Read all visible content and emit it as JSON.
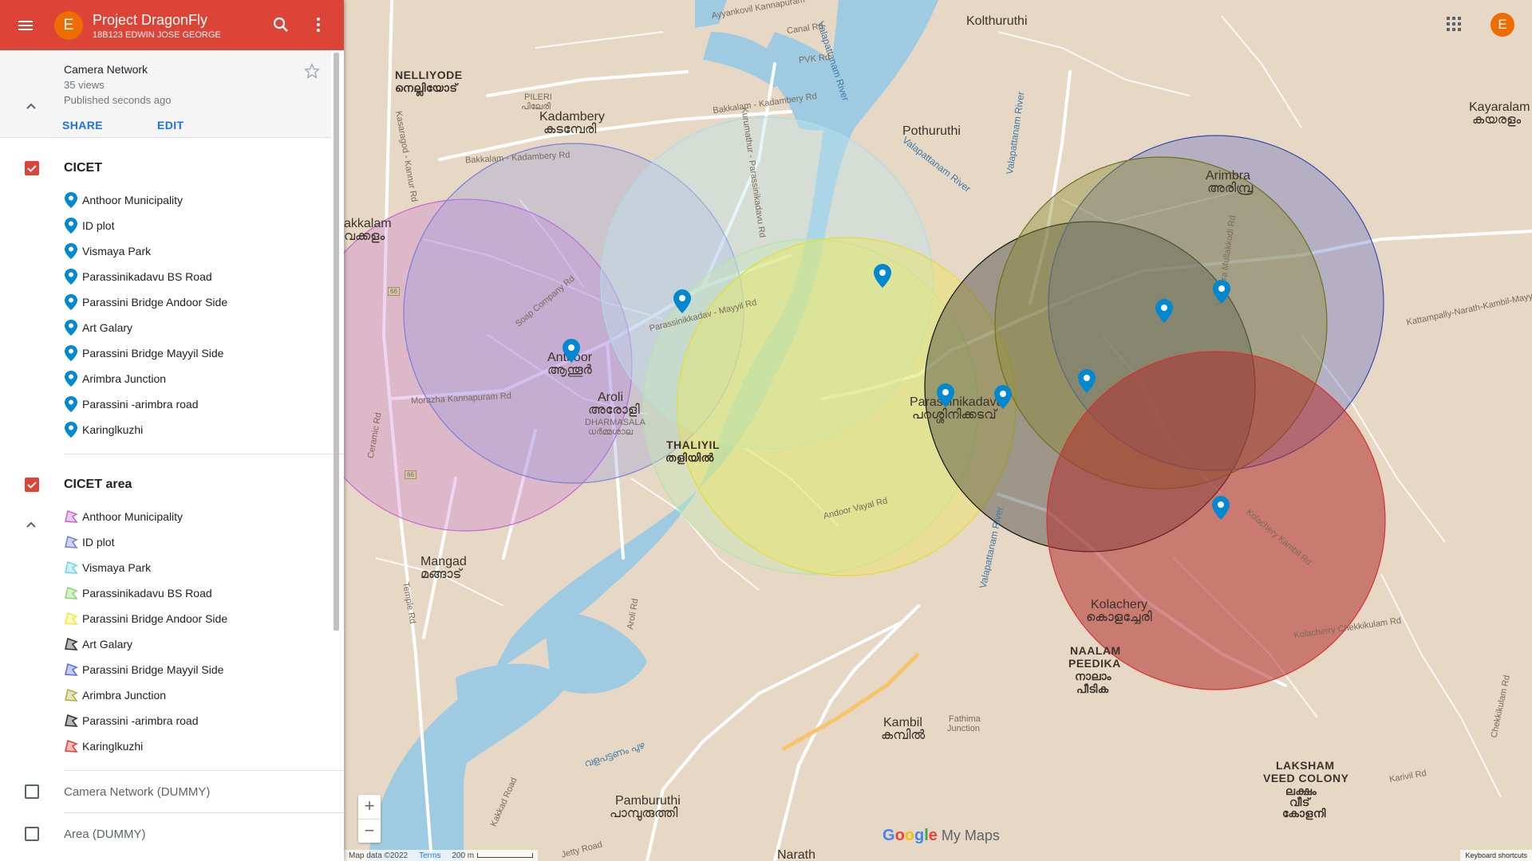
{
  "app": {
    "title": "Project DragonFly",
    "subtitle": "18B123 EDWIN JOSE GEORGE",
    "avatar_letter": "E"
  },
  "map_info": {
    "name": "Camera Network",
    "views": "35 views",
    "published": "Published seconds ago",
    "share_label": "SHARE",
    "edit_label": "EDIT"
  },
  "layers": [
    {
      "name": "CICET",
      "checked": true,
      "icon": "location-pin-icon",
      "items": [
        "Anthoor Municipality",
        "ID plot",
        "Vismaya Park",
        "Parassinikadavu BS Road",
        "Parassini Bridge Andoor Side",
        "Art Galary",
        "Parassini Bridge Mayyil Side",
        "Arimbra Junction",
        "Parassini -arimbra road",
        "Karinglkuzhi"
      ]
    },
    {
      "name": "CICET area",
      "checked": true,
      "icon": "polygon-area-icon",
      "items": [
        {
          "label": "Anthoor Municipality",
          "color": "#c766d9"
        },
        {
          "label": "ID plot",
          "color": "#7b7fd6"
        },
        {
          "label": "Vismaya Park",
          "color": "#6fd6e6"
        },
        {
          "label": "Parassinikadavu BS Road",
          "color": "#8fd66f"
        },
        {
          "label": "Parassini Bridge Andoor Side",
          "color": "#f2ea3d"
        },
        {
          "label": "Art Galary",
          "color": "#333333"
        },
        {
          "label": "Parassini Bridge Mayyil Side",
          "color": "#5a6ee6"
        },
        {
          "label": "Arimbra Junction",
          "color": "#b0b040"
        },
        {
          "label": "Parassini -arimbra road",
          "color": "#333333"
        },
        {
          "label": "Karinglkuzhi",
          "color": "#e63d3d"
        }
      ]
    },
    {
      "name": "Camera Network (DUMMY)",
      "checked": false
    },
    {
      "name": "Area (DUMMY)",
      "checked": false
    }
  ],
  "map": {
    "place_labels": {
      "kolthuruthi": "Kolthuruthi",
      "nelliyode": "NELLIYODE",
      "nelliyode_ml": "നെല്ലിയോട്",
      "kadambery": "Kadambery",
      "kadambery_ml": "കടമ്പേരി",
      "pilleri": "PILERI",
      "pilleri_ml": "പിലേരി",
      "pothuruthi": "Pothuruthi",
      "bakkalam": "akkalam",
      "bakkalam_ml": "വക്കളം",
      "anthoor": "Anthoor",
      "anthoor_ml": "ആന്തൂർ",
      "aroli": "Aroli",
      "aroli_ml": "അരോളി",
      "dharmasala": "DHARMASALA",
      "dharmasala_ml": "ധർമ്മശാല",
      "thaliyil": "THALIYIL",
      "thaliyil_ml": "തളിയിൽ",
      "parassinikadavu": "Parassinikadavu",
      "parassinikadavu_ml": "പറശ്ശിനിക്കടവ്",
      "arimbra": "Arimbra",
      "arimbra_ml": "അരിമ്പ്ര",
      "kayaralam": "Kayaralam",
      "kayaralam_ml": "കയരളം",
      "mangad": "Mangad",
      "mangad_ml": "മങ്ങാട്",
      "kolachery": "Kolachery",
      "kolachery_ml": "കൊളച്ചേരി",
      "naalam": "NAALAM",
      "peedika": "PEEDIKA",
      "naalam_ml": "നാലാം",
      "peedika_ml": "പീടിക",
      "kambil": "Kambil",
      "kambil_ml": "കമ്പിൽ",
      "fathima": "Fathima",
      "junction": "Junction",
      "pamburuthi": "Pamburuthi",
      "pamburuthi_ml": "പാമ്പുരുത്തി",
      "laksham": "LAKSHAM",
      "veed_colony": "VEED COLONY",
      "laksham_ml": "ലക്ഷം",
      "veed_ml": "വീട്",
      "colony_ml": "കോളനി",
      "narath": "Narath"
    },
    "road_labels": {
      "r1": "Bakkalam - Kadambery Rd",
      "r2": "Bakkalam - Kadambery Rd",
      "r3": "Kasaragod - Kannur Rd",
      "r4": "Morazha Kannapuram Rd",
      "r5": "Parassinikkadav - Mayyil Rd",
      "r6": "Soap Company Rd",
      "r7": "Kurumathur - Parassinikadavu Rd",
      "r8": "Valapattanam River",
      "r9": "Valapattanam River",
      "r10": "Valapattanam River",
      "r11": "Kattampally-Narath-Kambil-Mayyil Rd",
      "r12": "Kolachery Kambil Rd",
      "r13": "Kolacherry Chekkikulam Rd",
      "r14": "Andoor Vayal Rd",
      "r15": "Valapattanam River",
      "r16": "Vengara Mullakkodi Rd",
      "r17": "Aroli Rd",
      "r18": "Kakkad Road",
      "r19": "Jetty Road",
      "r20": "Canal Rd",
      "r21": "PVK Rd",
      "r22": "Karivil Rd",
      "r23": "Ceramic Rd",
      "r24": "Temple Rd",
      "r25": "വളപട്ടണം പുഴ",
      "r26": "Ayyankovil Kannapuram",
      "r27": "Chekkikulam Rd"
    },
    "highway_shield": "66",
    "circle_colors": [
      "#c766d9",
      "#7b7fd6",
      "#a9dfe8",
      "#b5e3a6",
      "#f2ea3d",
      "#333333",
      "#5a6ee6",
      "#b0b040",
      "#333333",
      "#e63d3d"
    ],
    "attribution": "Map data ©2022",
    "terms": "Terms",
    "scale": "200 m",
    "keyboard_shortcuts": "Keyboard shortcuts",
    "zoom_in": "+",
    "zoom_out": "−",
    "watermark": {
      "g1": "G",
      "g2": "o",
      "g3": "o",
      "g4": "g",
      "g5": "l",
      "g6": "e",
      "product": "My Maps"
    }
  }
}
